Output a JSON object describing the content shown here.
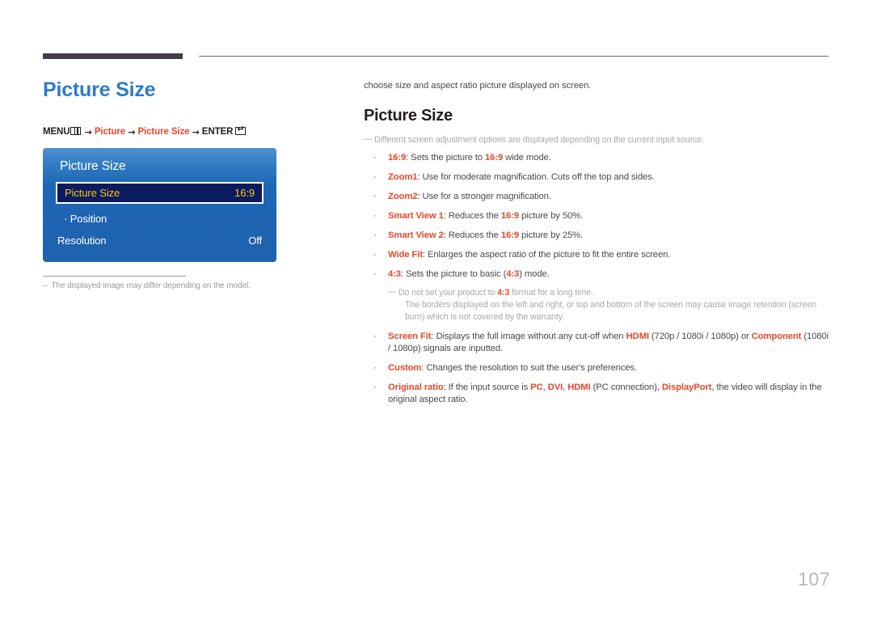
{
  "decor": {
    "thick_rule_color": "#433a4e",
    "thin_rule_color": "#6e7076"
  },
  "left": {
    "title": "Picture Size",
    "title_color": "#2e7cc4",
    "menu_path": {
      "menu_label": "MENU",
      "menu_icon": "menu-grid-icon",
      "arrow": "→",
      "item1": "Picture",
      "item2": "Picture Size",
      "enter_label": "ENTER",
      "enter_icon": "enter-key-icon",
      "accent_color": "#e8472a"
    },
    "osd": {
      "title": "Picture Size",
      "rows": [
        {
          "label": "Picture Size",
          "value": "16:9",
          "selected": true
        },
        {
          "label": "· Position",
          "value": "",
          "selected": false
        },
        {
          "label": "Resolution",
          "value": "Off",
          "selected": false
        }
      ],
      "bg_top": "#4e91d0",
      "bg_bottom": "#1f62ae",
      "selected_bg": "#0c1b5e",
      "selected_text": "#f5c518"
    },
    "footnote": {
      "dash": "–",
      "text": "The displayed image may differ depending on the model."
    }
  },
  "right": {
    "intro": "choose size and aspect ratio picture displayed on screen.",
    "title": "Picture Size",
    "note": {
      "dash": "—",
      "text": "Different screen adjustment options are displayed depending on the current input source."
    },
    "bullets": [
      {
        "bullet": "·",
        "segments": [
          {
            "t": "16:9",
            "red": true
          },
          {
            "t": ": Sets the picture to ",
            "red": false
          },
          {
            "t": "16:9",
            "red": true
          },
          {
            "t": " wide mode.",
            "red": false
          }
        ]
      },
      {
        "bullet": "·",
        "segments": [
          {
            "t": "Zoom1",
            "red": true
          },
          {
            "t": ": Use for moderate magnification. Cuts off the top and sides.",
            "red": false
          }
        ]
      },
      {
        "bullet": "·",
        "segments": [
          {
            "t": "Zoom2",
            "red": true
          },
          {
            "t": ": Use for a stronger magnification.",
            "red": false
          }
        ]
      },
      {
        "bullet": "·",
        "segments": [
          {
            "t": "Smart View 1",
            "red": true
          },
          {
            "t": ": Reduces the ",
            "red": false
          },
          {
            "t": "16:9",
            "red": true
          },
          {
            "t": " picture by 50%.",
            "red": false
          }
        ]
      },
      {
        "bullet": "·",
        "segments": [
          {
            "t": "Smart View 2",
            "red": true
          },
          {
            "t": ": Reduces the ",
            "red": false
          },
          {
            "t": "16:9",
            "red": true
          },
          {
            "t": " picture by 25%.",
            "red": false
          }
        ]
      },
      {
        "bullet": "·",
        "segments": [
          {
            "t": "Wide Fit",
            "red": true
          },
          {
            "t": ": Enlarges the aspect ratio of the picture to fit the entire screen.",
            "red": false
          }
        ]
      },
      {
        "bullet": "·",
        "segments": [
          {
            "t": "4:3",
            "red": true
          },
          {
            "t": ": Sets the picture to basic (",
            "red": false
          },
          {
            "t": "4:3",
            "red": true
          },
          {
            "t": ") mode.",
            "red": false
          }
        ]
      }
    ],
    "sub_note": {
      "dash": "—",
      "segments": [
        {
          "t": "Do not set your product to ",
          "red": false
        },
        {
          "t": "4:3",
          "red": true
        },
        {
          "t": " format for a long time.",
          "red": false
        }
      ],
      "continuation": "The borders displayed on the left and right, or top and bottom of the screen may cause image retention (screen burn) which is not covered by the warranty."
    },
    "bullets2": [
      {
        "bullet": "·",
        "segments": [
          {
            "t": "Screen Fit",
            "red": true
          },
          {
            "t": ": Displays the full image without any cut-off when ",
            "red": false
          },
          {
            "t": "HDMI",
            "red": true
          },
          {
            "t": " (720p / 1080i / 1080p) or ",
            "red": false
          },
          {
            "t": "Component",
            "red": true
          },
          {
            "t": " (1080i / 1080p) signals are inputted.",
            "red": false
          }
        ]
      },
      {
        "bullet": "·",
        "segments": [
          {
            "t": "Custom",
            "red": true
          },
          {
            "t": ": Changes the resolution to suit the user's preferences.",
            "red": false
          }
        ]
      },
      {
        "bullet": "·",
        "segments": [
          {
            "t": "Original ratio",
            "red": true
          },
          {
            "t": ": If the input source is ",
            "red": false
          },
          {
            "t": "PC",
            "red": true
          },
          {
            "t": ", ",
            "red": false
          },
          {
            "t": "DVI",
            "red": true
          },
          {
            "t": ", ",
            "red": false
          },
          {
            "t": "HDMI",
            "red": true
          },
          {
            "t": " (PC connection), ",
            "red": false
          },
          {
            "t": "DisplayPort",
            "red": true
          },
          {
            "t": ", the video will display in the original aspect ratio.",
            "red": false
          }
        ]
      }
    ]
  },
  "page_number": "107"
}
